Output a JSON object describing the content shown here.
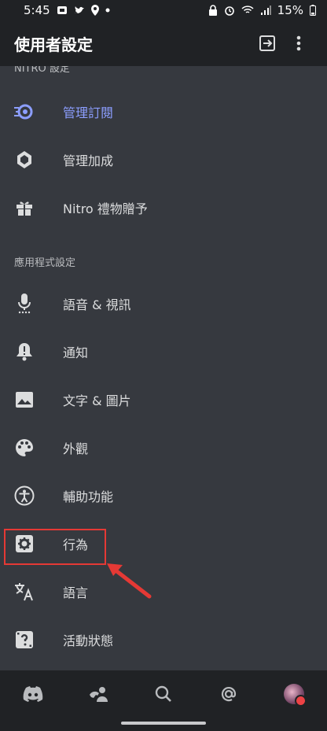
{
  "statusbar": {
    "time": "5:45",
    "battery": "15%"
  },
  "appbar": {
    "title": "使用者設定"
  },
  "sections": {
    "nitro_header": "NITRO 設定",
    "app_header": "應用程式設定"
  },
  "items": [
    {
      "label": "管理訂閱",
      "icon": "nitro-subscription-icon"
    },
    {
      "label": "管理加成",
      "icon": "server-boost-icon"
    },
    {
      "label": "Nitro 禮物贈予",
      "icon": "gift-icon"
    },
    {
      "label": "語音 & 視訊",
      "icon": "microphone-icon"
    },
    {
      "label": "通知",
      "icon": "bell-icon"
    },
    {
      "label": "文字 & 圖片",
      "icon": "image-icon"
    },
    {
      "label": "外觀",
      "icon": "palette-icon"
    },
    {
      "label": "輔助功能",
      "icon": "accessibility-icon"
    },
    {
      "label": "行為",
      "icon": "gear-icon"
    },
    {
      "label": "語言",
      "icon": "translate-icon"
    },
    {
      "label": "活動狀態",
      "icon": "activity-icon"
    }
  ],
  "colors": {
    "accent": "#8c9eff",
    "highlight": "#e53935"
  }
}
